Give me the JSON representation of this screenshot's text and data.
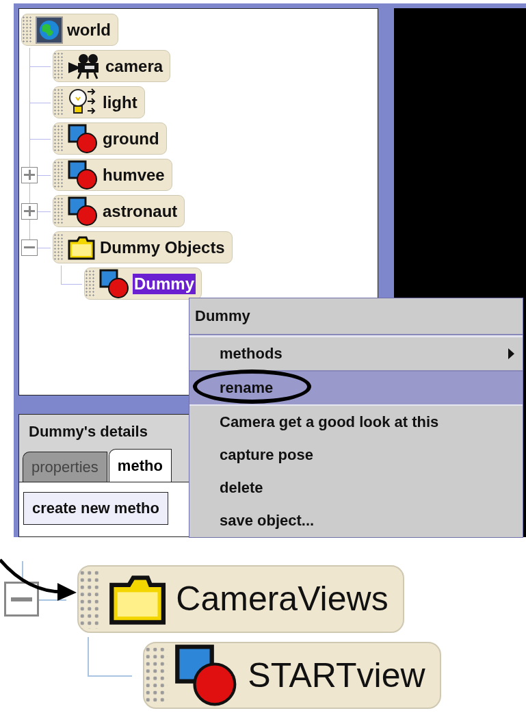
{
  "object_tree": {
    "items": [
      {
        "label": "world",
        "kind": "world",
        "selected": false,
        "children": [
          {
            "label": "camera",
            "kind": "camera",
            "selected": false
          },
          {
            "label": "light",
            "kind": "light",
            "selected": false
          },
          {
            "label": "ground",
            "kind": "object",
            "selected": false
          },
          {
            "label": "humvee",
            "kind": "object",
            "selected": false,
            "expanded": false
          },
          {
            "label": "astronaut",
            "kind": "object",
            "selected": false,
            "expanded": false
          },
          {
            "label": "Dummy Objects",
            "kind": "folder",
            "selected": false,
            "expanded": true,
            "children": [
              {
                "label": "Dummy",
                "kind": "object",
                "selected": true
              }
            ]
          }
        ]
      }
    ]
  },
  "context_menu": {
    "title": "Dummy",
    "items": [
      {
        "label": "methods",
        "submenu": true,
        "selected": false
      },
      {
        "label": "rename",
        "submenu": false,
        "selected": true
      },
      {
        "label": "Camera get a good look at this",
        "submenu": false,
        "selected": false
      },
      {
        "label": "capture pose",
        "submenu": false,
        "selected": false
      },
      {
        "label": "delete",
        "submenu": false,
        "selected": false
      },
      {
        "label": "save object...",
        "submenu": false,
        "selected": false
      }
    ]
  },
  "details": {
    "title": "Dummy's details",
    "tabs": [
      {
        "label": "properties",
        "selected": false
      },
      {
        "label": "metho",
        "selected": true
      }
    ],
    "button": "create new metho"
  },
  "zoomed_view": {
    "items": [
      {
        "label": "CameraViews",
        "kind": "folder",
        "selected": false,
        "expanded": true,
        "children": [
          {
            "label": "STARTview",
            "kind": "object",
            "selected": false
          }
        ]
      }
    ]
  }
}
